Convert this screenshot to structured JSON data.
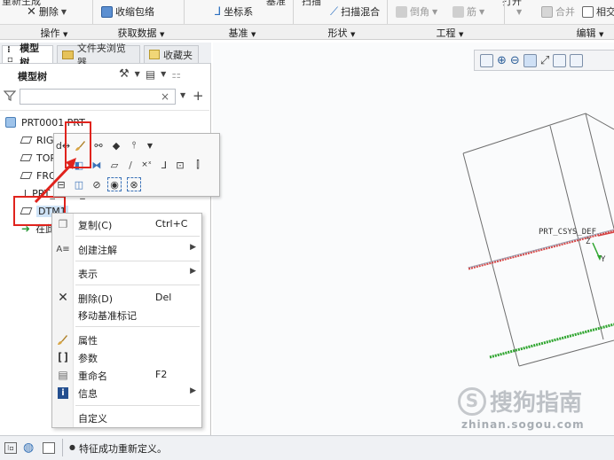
{
  "ribbon": {
    "cut_top_left": "重新生成",
    "cut_top_baseline": "基准",
    "cut_top_sweep": "扫描",
    "cut_top_open": "打开",
    "delete_label": "删除",
    "shrinkwrap_label": "收缩包络",
    "csys_label": "坐标系",
    "sweep_blend_label": "扫描混合",
    "round_label": "倒角",
    "rib_label": "筋",
    "merge_label": "合并",
    "intersect_label": "相交",
    "groups": [
      "操作",
      "获取数据",
      "基准",
      "形状",
      "工程",
      "编辑"
    ]
  },
  "navigator": {
    "tabs": [
      "模型树",
      "文件夹浏览器",
      "收藏夹"
    ],
    "tree_header": "模型树",
    "search_placeholder": "",
    "clear_symbol": "×",
    "items": [
      {
        "label": "PRT0001.PRT",
        "icon": "part-icon"
      },
      {
        "label": "RIGHT",
        "icon": "datum-plane-icon"
      },
      {
        "label": "TOP",
        "icon": "datum-plane-icon"
      },
      {
        "label": "FRONT",
        "icon": "datum-plane-icon"
      },
      {
        "label": "PRT_CSYS_DEF",
        "icon": "csys-icon"
      },
      {
        "label": "DTM1",
        "icon": "datum-plane-icon"
      },
      {
        "label": "在此插入",
        "icon": "insert-arrow-icon"
      }
    ]
  },
  "context_menu": {
    "items": [
      {
        "label": "复制(C)",
        "shortcut": "Ctrl+C",
        "icon": "copy-icon",
        "submenu": false
      },
      {
        "label": "创建注解",
        "shortcut": "",
        "icon": "annotation-icon",
        "submenu": true
      },
      {
        "label": "表示",
        "shortcut": "",
        "icon": "",
        "submenu": true
      },
      {
        "label": "删除(D)",
        "shortcut": "Del",
        "icon": "delete-x-icon",
        "submenu": false
      },
      {
        "label": "移动基准标记",
        "shortcut": "",
        "icon": "",
        "submenu": false
      },
      {
        "label": "属性",
        "shortcut": "",
        "icon": "properties-brush-icon",
        "submenu": false
      },
      {
        "label": "参数",
        "shortcut": "",
        "icon": "parameters-braces-icon",
        "submenu": false
      },
      {
        "label": "重命名",
        "shortcut": "F2",
        "icon": "rename-icon",
        "submenu": false
      },
      {
        "label": "信息",
        "shortcut": "",
        "icon": "info-icon",
        "submenu": true
      },
      {
        "label": "自定义",
        "shortcut": "",
        "icon": "",
        "submenu": false
      }
    ]
  },
  "graphics": {
    "csys_label": "PRT_CSYS_DEF",
    "axis_z": "Z",
    "axis_y": "Y"
  },
  "watermark": {
    "brand": "搜狗指南",
    "url": "zhinan.sogou.com"
  },
  "status": {
    "message": "特征成功重新定义。"
  },
  "colors": {
    "highlight_box": "#e0231d",
    "annotation_arrow": "#e0231d",
    "selection_blue": "#cfe3f7",
    "datum_green": "#2fa52f",
    "datum_red": "#d64545"
  }
}
